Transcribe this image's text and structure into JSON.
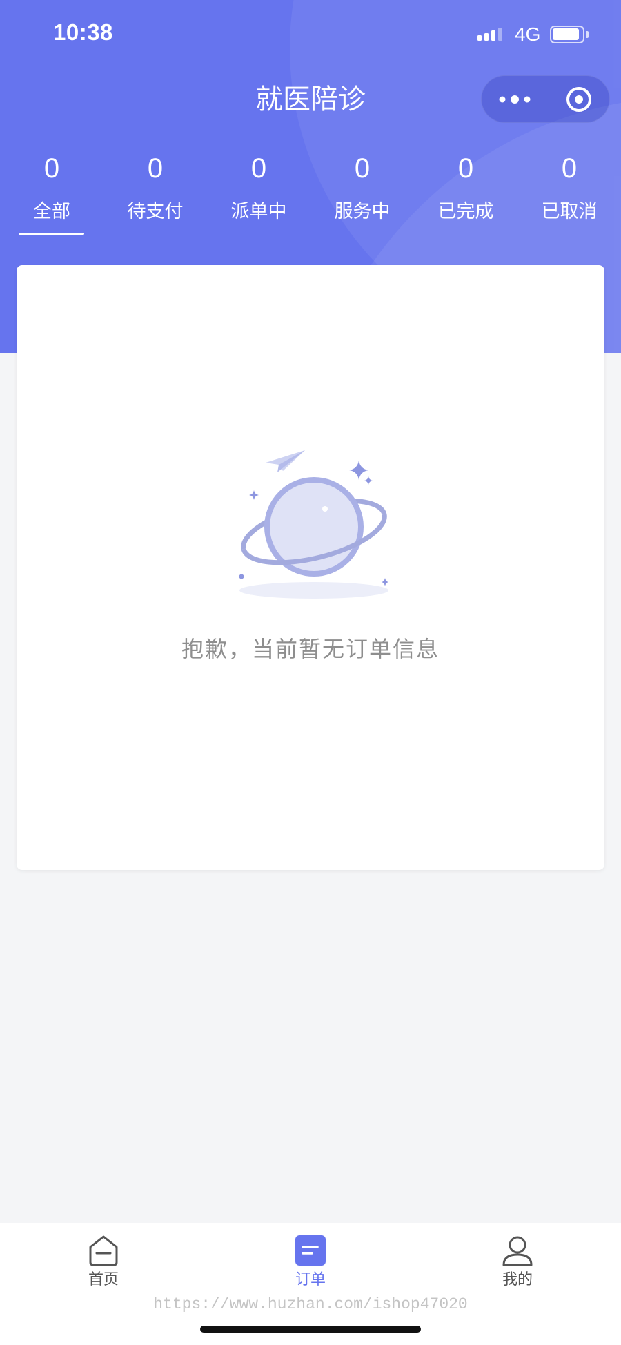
{
  "status_bar": {
    "time": "10:38",
    "network": "4G",
    "signal_icon": "signal-icon",
    "battery_icon": "battery-icon"
  },
  "header": {
    "title": "就医陪诊",
    "background_color": "#6674ee"
  },
  "capsule": {
    "more_icon": "more-dots-icon",
    "close_icon": "target-circle-icon"
  },
  "order_tabs": [
    {
      "count": "0",
      "label": "全部",
      "active": true
    },
    {
      "count": "0",
      "label": "待支付",
      "active": false
    },
    {
      "count": "0",
      "label": "派单中",
      "active": false
    },
    {
      "count": "0",
      "label": "服务中",
      "active": false
    },
    {
      "count": "0",
      "label": "已完成",
      "active": false
    },
    {
      "count": "0",
      "label": "已取消",
      "active": false
    }
  ],
  "empty_state": {
    "icon": "planet-illustration",
    "message": "抱歉，当前暂无订单信息"
  },
  "tab_bar": {
    "active_color": "#6674ee",
    "items": [
      {
        "label": "首页",
        "icon": "home-icon",
        "active": false
      },
      {
        "label": "订单",
        "icon": "order-icon",
        "active": true
      },
      {
        "label": "我的",
        "icon": "user-icon",
        "active": false
      }
    ]
  },
  "watermark": "https://www.huzhan.com/ishop47020"
}
